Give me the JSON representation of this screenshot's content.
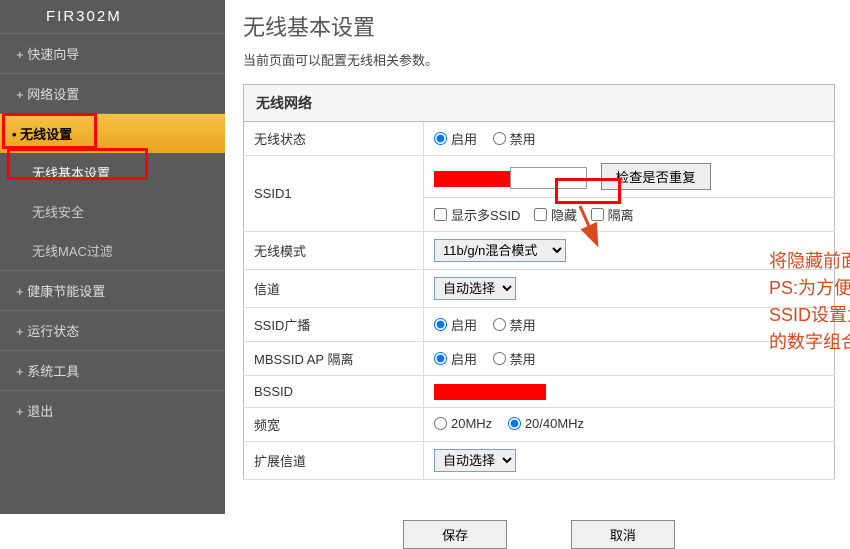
{
  "router_model": "FIR302M",
  "sidebar": {
    "items": [
      {
        "label": "快速向导"
      },
      {
        "label": "网络设置"
      },
      {
        "label": "无线设置",
        "active": true,
        "sub": [
          {
            "label": "无线基本设置",
            "current": true
          },
          {
            "label": "无线安全"
          },
          {
            "label": "无线MAC过滤"
          }
        ]
      },
      {
        "label": "健康节能设置"
      },
      {
        "label": "运行状态"
      },
      {
        "label": "系统工具"
      },
      {
        "label": "退出"
      }
    ]
  },
  "page": {
    "title": "无线基本设置",
    "subtitle": "当前页面可以配置无线相关参数。"
  },
  "form": {
    "section_title": "无线网络",
    "rows": {
      "status": {
        "label": "无线状态",
        "on": "启用",
        "off": "禁用",
        "value": "on"
      },
      "ssid1": {
        "label": "SSID1",
        "check_btn": "检查是否重复",
        "show_multi": "显示多SSID",
        "hide": "隐藏",
        "isolate": "隔离"
      },
      "mode": {
        "label": "无线模式",
        "options": [
          "11b/g/n混合模式"
        ],
        "selected": "11b/g/n混合模式"
      },
      "channel": {
        "label": "信道",
        "options": [
          "自动选择"
        ],
        "selected": "自动选择"
      },
      "broadcast": {
        "label": "SSID广播",
        "on": "启用",
        "off": "禁用",
        "value": "on"
      },
      "mbssid": {
        "label": "MBSSID AP 隔离",
        "on": "启用",
        "off": "禁用",
        "value": "on"
      },
      "bssid": {
        "label": "BSSID"
      },
      "bandwidth": {
        "label": "频宽",
        "opt1": "20MHz",
        "opt2": "20/40MHz",
        "value": "2"
      },
      "ext_channel": {
        "label": "扩展信道",
        "options": [
          "自动选择"
        ],
        "selected": "自动选择"
      }
    }
  },
  "buttons": {
    "save": "保存",
    "cancel": "取消"
  },
  "annotation": {
    "line1": "将隐藏前面的勾打上",
    "line2": "PS:为方便记忆可将",
    "line3": "SSID设置为自己熟知",
    "line4": "的数字组合"
  }
}
